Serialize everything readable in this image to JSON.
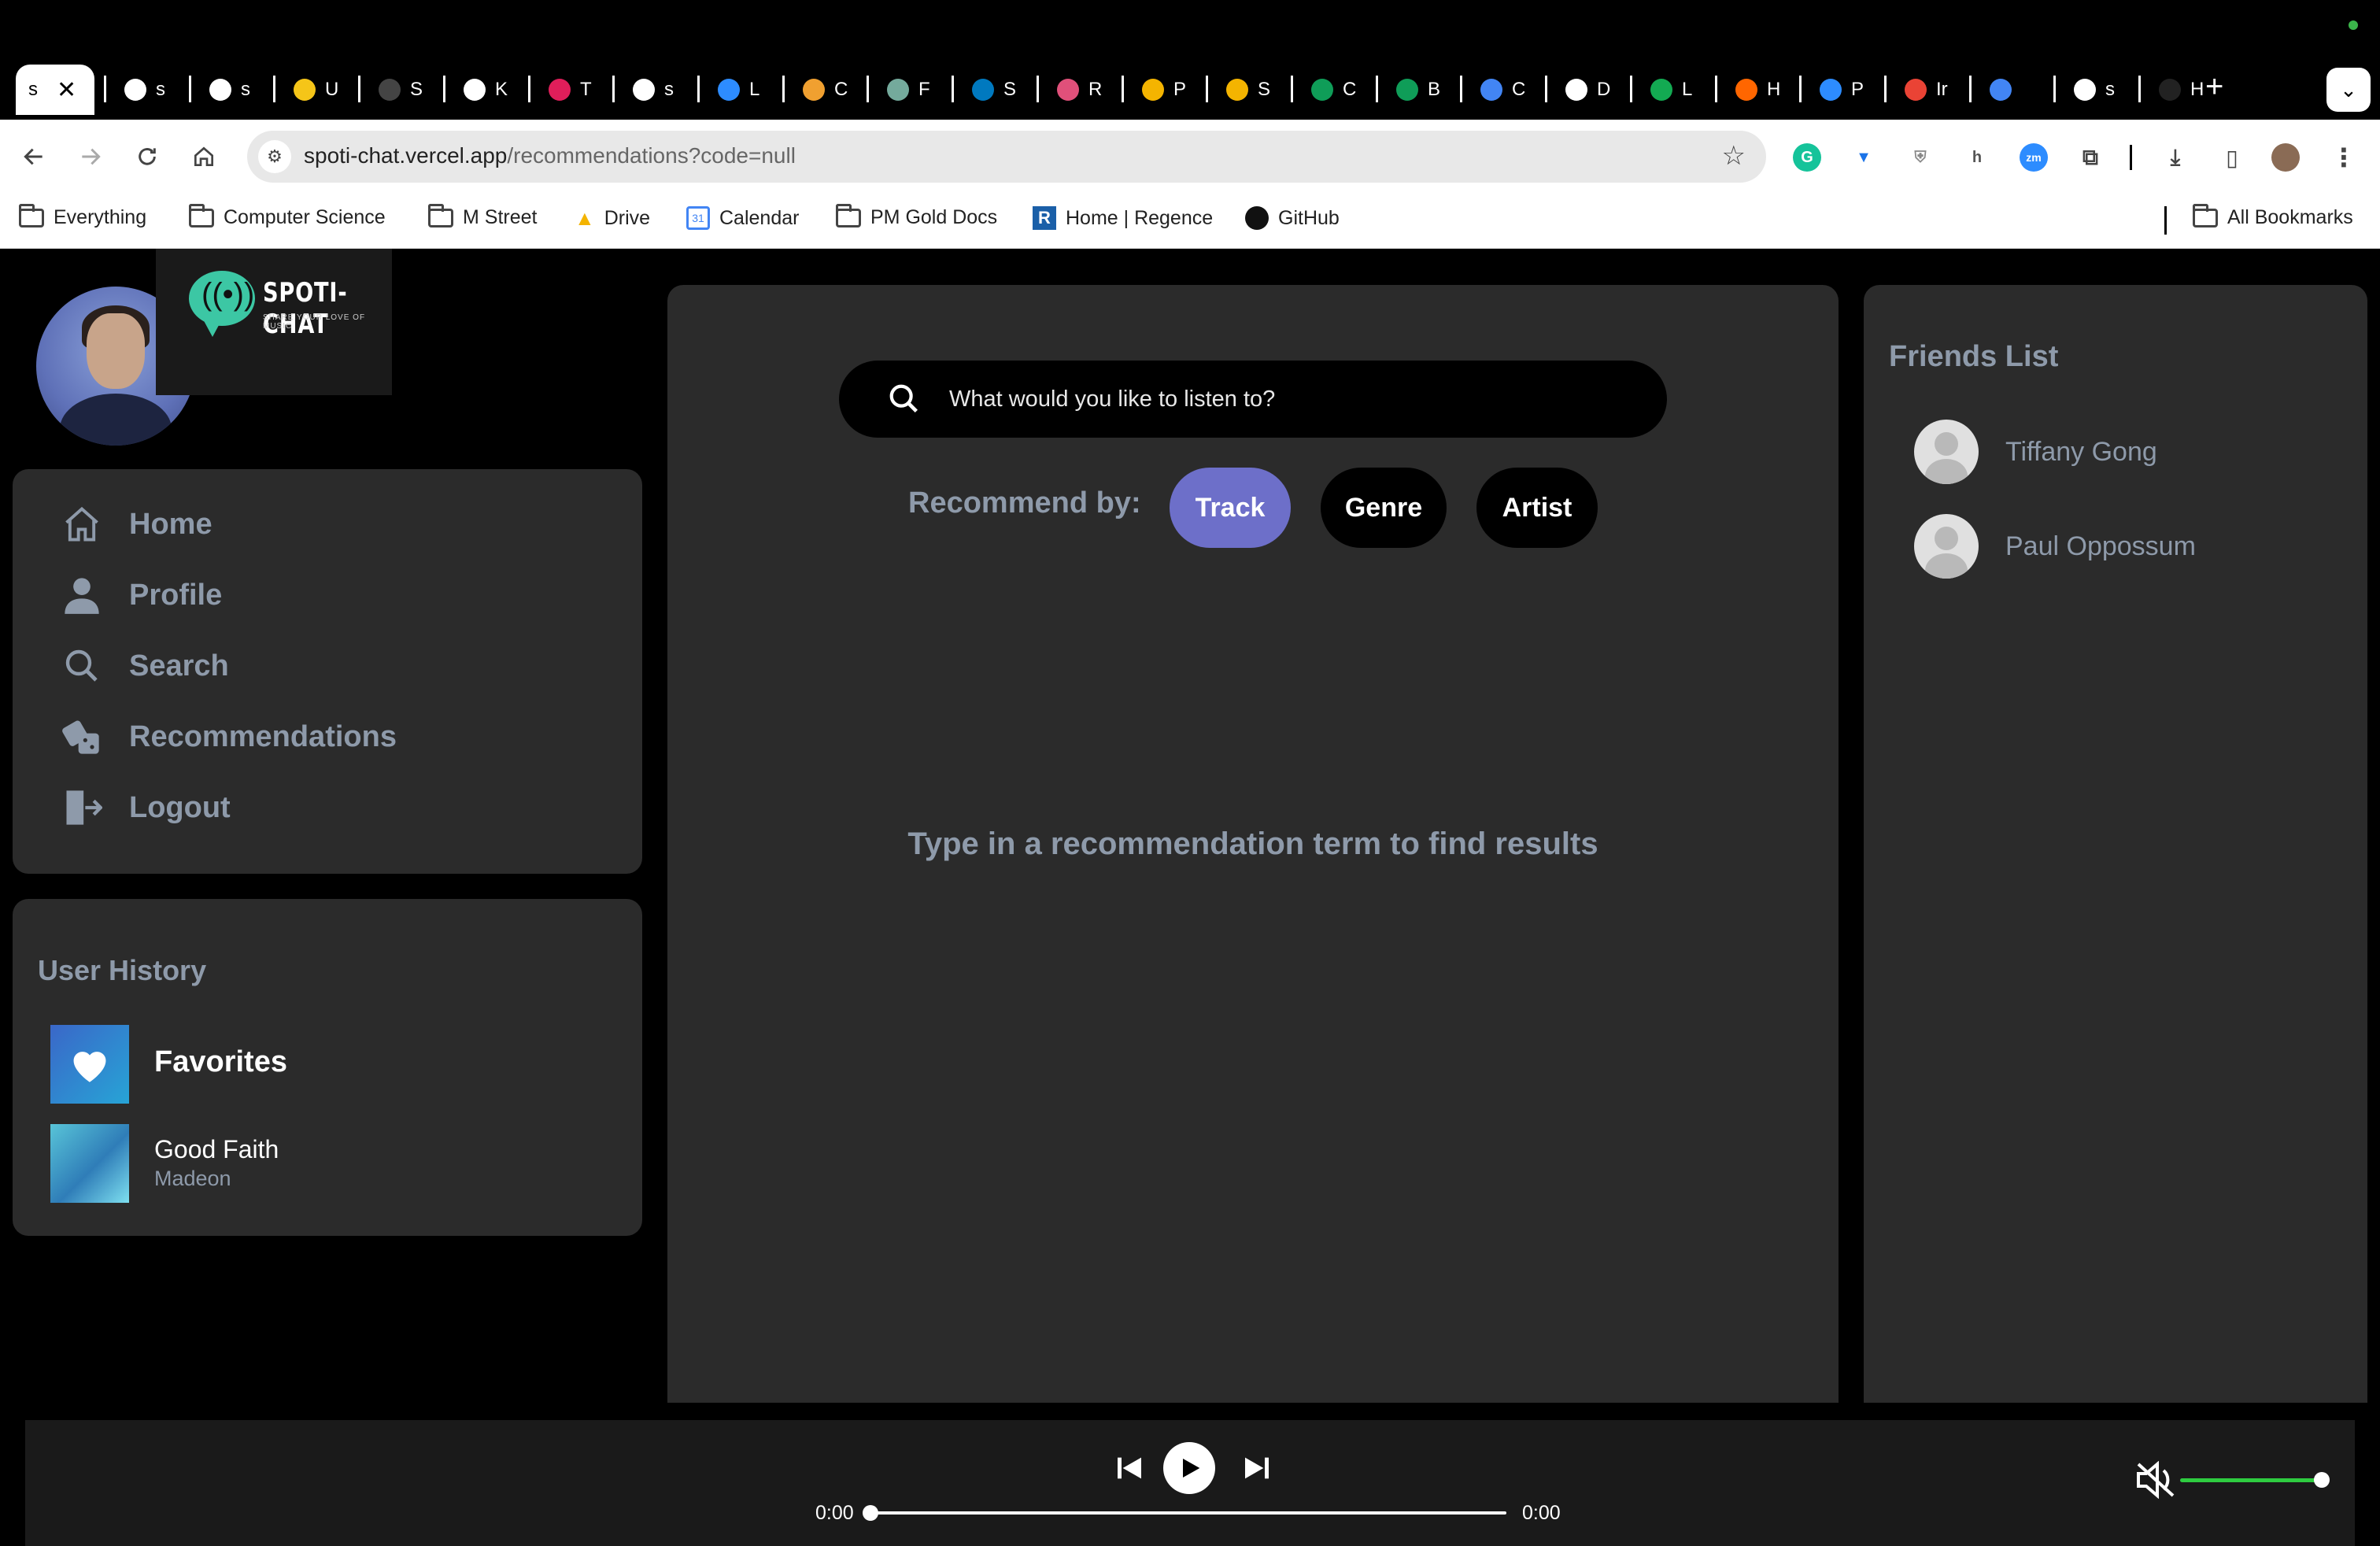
{
  "browser": {
    "tabs": [
      {
        "label": "s",
        "icon": "spotify-icon",
        "color": "#1a1a1a"
      },
      {
        "label": "s",
        "icon": "github-icon",
        "color": "#ffffff"
      },
      {
        "label": "s",
        "icon": "github-icon",
        "color": "#ffffff"
      },
      {
        "label": "U",
        "icon": "smiley-icon",
        "color": "#f5c518"
      },
      {
        "label": "S",
        "icon": "page-icon",
        "color": "#444444"
      },
      {
        "label": "K",
        "icon": "github-icon",
        "color": "#ffffff"
      },
      {
        "label": "T",
        "icon": "slack-icon",
        "color": "#e01e5a"
      },
      {
        "label": "s",
        "icon": "github-icon",
        "color": "#ffffff"
      },
      {
        "label": "L",
        "icon": "zoom-icon",
        "color": "#2d8cff"
      },
      {
        "label": "C",
        "icon": "leaf-icon",
        "color": "#f0a030"
      },
      {
        "label": "F",
        "icon": "openai-icon",
        "color": "#74aa9c"
      },
      {
        "label": "S",
        "icon": "trello-icon",
        "color": "#0079bf"
      },
      {
        "label": "R",
        "icon": "react-icon",
        "color": "#e0507a"
      },
      {
        "label": "P",
        "icon": "slides-icon",
        "color": "#f4b400"
      },
      {
        "label": "S",
        "icon": "slides-icon",
        "color": "#f4b400"
      },
      {
        "label": "C",
        "icon": "sheets-icon",
        "color": "#0f9d58"
      },
      {
        "label": "B",
        "icon": "sheets-icon",
        "color": "#0f9d58"
      },
      {
        "label": "C",
        "icon": "docs-icon",
        "color": "#4285f4"
      },
      {
        "label": "D",
        "icon": "notion-icon",
        "color": "#ffffff"
      },
      {
        "label": "L",
        "icon": "mongodb-icon",
        "color": "#13aa52"
      },
      {
        "label": "H",
        "icon": "ycombinator-icon",
        "color": "#ff6600"
      },
      {
        "label": "P",
        "icon": "zoom-icon",
        "color": "#2d8cff"
      },
      {
        "label": "Ir",
        "icon": "gmail-icon",
        "color": "#ea4335"
      },
      {
        "label": "",
        "icon": "docs-icon",
        "color": "#4285f4"
      },
      {
        "label": "s",
        "icon": "google-icon",
        "color": "#ffffff"
      },
      {
        "label": "H",
        "icon": "spotify-icon",
        "color": "#222222"
      }
    ],
    "url_host": "spoti-chat.vercel.app",
    "url_path": "/recommendations?code=null",
    "bookmarks": [
      {
        "label": "Everything",
        "icon": "folder-icon"
      },
      {
        "label": "Computer Science",
        "icon": "folder-icon"
      },
      {
        "label": "M Street",
        "icon": "folder-icon"
      },
      {
        "label": "Drive",
        "icon": "drive-icon"
      },
      {
        "label": "Calendar",
        "icon": "calendar-icon"
      },
      {
        "label": "PM Gold Docs",
        "icon": "folder-icon"
      },
      {
        "label": "Home | Regence",
        "icon": "regence-icon"
      },
      {
        "label": "GitHub",
        "icon": "github-icon"
      }
    ],
    "all_bookmarks": "All Bookmarks"
  },
  "brand": {
    "name": "SPOTI-CHAT",
    "tagline": "SHARE YOUR LOVE OF MUSIC"
  },
  "nav": {
    "items": [
      {
        "label": "Home",
        "icon": "home-icon"
      },
      {
        "label": "Profile",
        "icon": "user-icon"
      },
      {
        "label": "Search",
        "icon": "search-icon"
      },
      {
        "label": "Recommendations",
        "icon": "dice-icon"
      },
      {
        "label": "Logout",
        "icon": "logout-icon"
      }
    ]
  },
  "history": {
    "title": "User History",
    "favorites_label": "Favorites",
    "song": {
      "title": "Good Faith",
      "artist": "Madeon"
    }
  },
  "main": {
    "search_placeholder": "What would you like to listen to?",
    "recommend_label": "Recommend by:",
    "options": [
      "Track",
      "Genre",
      "Artist"
    ],
    "selected": "Track",
    "empty_message": "Type in a recommendation term to find results"
  },
  "friends": {
    "title": "Friends List",
    "list": [
      "Tiffany Gong",
      "Paul Oppossum"
    ]
  },
  "player": {
    "current_time": "0:00",
    "total_time": "0:00",
    "progress": 0,
    "volume": 1.0
  },
  "colors": {
    "accent": "#6d6fc9",
    "volume": "#2ecc40",
    "muted_text": "#8e9aaa"
  }
}
